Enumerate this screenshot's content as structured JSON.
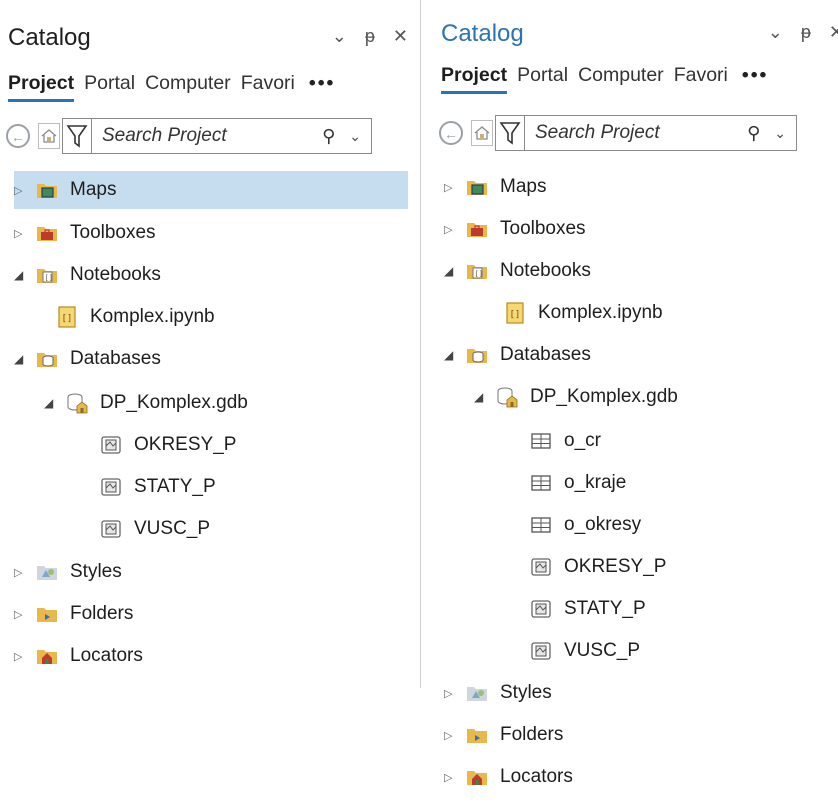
{
  "left": {
    "title": "Catalog",
    "controls": {
      "options": "⌄",
      "pin": "ᵽ",
      "close": "✕"
    },
    "tabs": [
      "Project",
      "Portal",
      "Computer",
      "Favori"
    ],
    "more": "•••",
    "search_placeholder": "Search Project",
    "tree": {
      "maps": "Maps",
      "toolboxes": "Toolboxes",
      "notebooks": "Notebooks",
      "notebook_file": "Komplex.ipynb",
      "databases": "Databases",
      "gdb": "DP_Komplex.gdb",
      "fc1": "OKRESY_P",
      "fc2": "STATY_P",
      "fc3": "VUSC_P",
      "styles": "Styles",
      "folders": "Folders",
      "locators": "Locators"
    }
  },
  "right": {
    "title": "Catalog",
    "controls": {
      "options": "⌄",
      "pin": "ᵽ",
      "close": "✕"
    },
    "tabs": [
      "Project",
      "Portal",
      "Computer",
      "Favori"
    ],
    "more": "•••",
    "search_placeholder": "Search Project",
    "tree": {
      "maps": "Maps",
      "toolboxes": "Toolboxes",
      "notebooks": "Notebooks",
      "notebook_file": "Komplex.ipynb",
      "databases": "Databases",
      "gdb": "DP_Komplex.gdb",
      "t1": "o_cr",
      "t2": "o_kraje",
      "t3": "o_okresy",
      "fc1": "OKRESY_P",
      "fc2": "STATY_P",
      "fc3": "VUSC_P",
      "styles": "Styles",
      "folders": "Folders",
      "locators": "Locators"
    }
  },
  "colors": {
    "accent": "#2a73b5",
    "selection": "#c6dcef",
    "folder": "#e8b84a"
  }
}
